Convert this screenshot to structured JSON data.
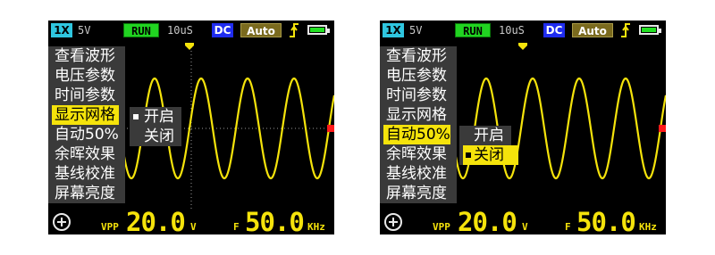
{
  "screens": [
    {
      "top": {
        "probe": "1X",
        "volt": "5V",
        "run": "RUN",
        "time": "10uS",
        "coupling": "DC",
        "trigger": "Auto",
        "edge_icon": "rising-edge-icon",
        "battery_icon": "battery-icon"
      },
      "menu": [
        "查看波形",
        "电压参数",
        "时间参数",
        "显示网格",
        "自动50%",
        "余晖效果",
        "基线校准",
        "屏幕亮度"
      ],
      "menu_selected_index": 3,
      "submenu": [
        "开启",
        "关闭"
      ],
      "submenu_selected_index": 0,
      "grid_visible": true,
      "bottom": {
        "vpp_label": "VPP",
        "vpp_value": "20.0",
        "vpp_unit": "V",
        "f_label": "F",
        "f_value": "50.0",
        "f_unit": "KHz"
      }
    },
    {
      "top": {
        "probe": "1X",
        "volt": "5V",
        "run": "RUN",
        "time": "10uS",
        "coupling": "DC",
        "trigger": "Auto",
        "edge_icon": "rising-edge-icon",
        "battery_icon": "battery-icon"
      },
      "menu": [
        "查看波形",
        "电压参数",
        "时间参数",
        "显示网格",
        "自动50%",
        "余晖效果",
        "基线校准",
        "屏幕亮度"
      ],
      "menu_selected_index": 4,
      "submenu": [
        "开启",
        "关闭"
      ],
      "submenu_selected_index": 1,
      "grid_visible": false,
      "bottom": {
        "vpp_label": "VPP",
        "vpp_value": "20.0",
        "vpp_unit": "V",
        "f_label": "F",
        "f_value": "50.0",
        "f_unit": "KHz"
      }
    }
  ],
  "colors": {
    "trace": "#f5e30b",
    "menu_bg": "#3a3a3a",
    "highlight": "#f5e30b",
    "probe": "#2fc6df",
    "run": "#21d421",
    "coupling": "#1f2cf0",
    "trigger": "#7a6a1e",
    "level_marker": "#ff1a1a"
  }
}
